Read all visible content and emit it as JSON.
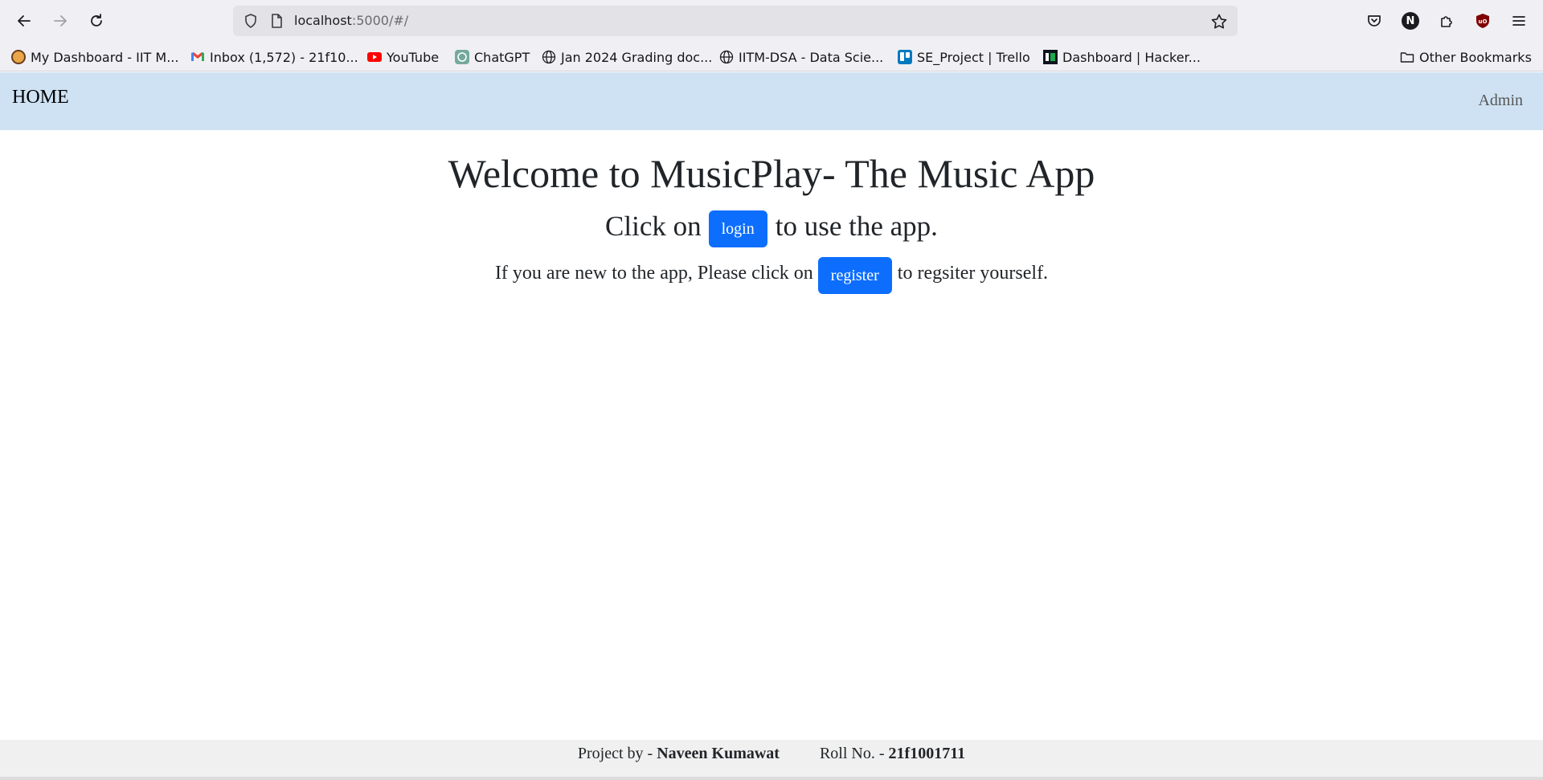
{
  "browser": {
    "url_host": "localhost",
    "url_rest": ":5000/#/",
    "bookmarks": [
      {
        "label": "My Dashboard - IIT M...",
        "icon": "avatar-icon"
      },
      {
        "label": "Inbox (1,572) - 21f10...",
        "icon": "gmail-icon"
      },
      {
        "label": "YouTube",
        "icon": "youtube-icon"
      },
      {
        "label": "ChatGPT",
        "icon": "chatgpt-icon"
      },
      {
        "label": "Jan 2024 Grading doc...",
        "icon": "globe-icon"
      },
      {
        "label": "IITM-DSA - Data Scie...",
        "icon": "globe-icon"
      },
      {
        "label": "SE_Project | Trello",
        "icon": "trello-icon"
      },
      {
        "label": "Dashboard | Hacker...",
        "icon": "hackerrank-icon"
      }
    ],
    "other_bookmarks": "Other Bookmarks",
    "profile_initial": "N"
  },
  "navbar": {
    "brand": "HOME",
    "admin": "Admin"
  },
  "main": {
    "title": "Welcome to MusicPlay- The Music App",
    "login_prefix": "Click on",
    "login_button": "login",
    "login_suffix": "to use the app.",
    "register_prefix": "If you are new to the app, Please click on",
    "register_button": "register",
    "register_suffix": "to regsiter yourself."
  },
  "footer": {
    "project_label": "Project by -",
    "project_name": "Naveen Kumawat",
    "roll_label": "Roll No. -",
    "roll_number": "21f1001711"
  },
  "colors": {
    "navbar_bg": "#cfe2f3",
    "button_bg": "#0d6efd",
    "footer_bg": "#f0f0f0"
  }
}
